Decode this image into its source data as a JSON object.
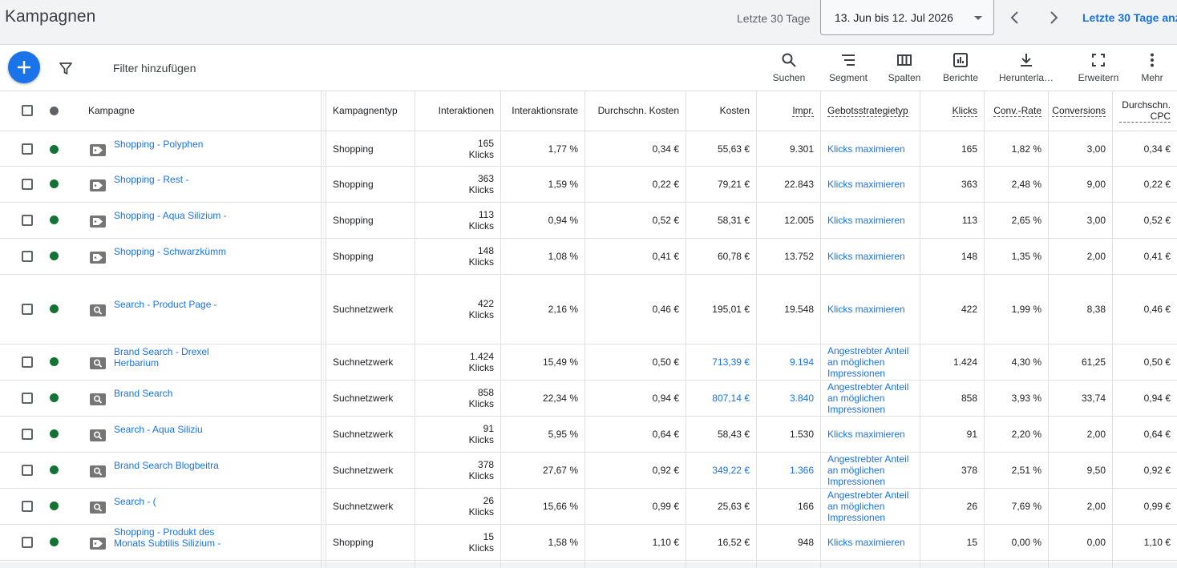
{
  "header": {
    "title": "Kampagnen",
    "range_label": "Letzte 30 Tage",
    "date_range": "13. Jun bis 12. Jul 2026",
    "compare_link": "Letzte 30 Tage anz"
  },
  "toolbar": {
    "filter_placeholder": "Filter hinzufügen",
    "search": "Suchen",
    "segment": "Segment",
    "columns": "Spalten",
    "reports": "Berichte",
    "download": "Herunterla…",
    "expand": "Erweitern",
    "more": "Mehr"
  },
  "table": {
    "columns": {
      "campaign": "Kampagne",
      "type": "Kampagnentyp",
      "interactions": "Interaktionen",
      "interaction_rate": "Interaktionsrate",
      "avg_cost": "Durchschn. Kosten",
      "cost": "Kosten",
      "impr": "Impr.",
      "bid_strategy": "Gebotsstrategietyp",
      "clicks": "Klicks",
      "conv_rate": "Conv.-Rate",
      "conversions": "Conversions",
      "avg_cpc": "Durchschn. CPC"
    },
    "status_color": "#137333",
    "rows": [
      {
        "name": "Shopping - Polyphen",
        "icon": "tag-icon",
        "type": "Shopping",
        "interactions": "165",
        "interactions_unit": "Klicks",
        "interaction_rate": "1,77 %",
        "avg_cost": "0,34 €",
        "cost": "55,63 €",
        "impr": "9.301",
        "bid_strategy": "Klicks maximieren",
        "clicks": "165",
        "conv_rate": "1,82 %",
        "conversions": "3,00",
        "avg_cpc": "0,34 €"
      },
      {
        "name": "Shopping - Rest -",
        "icon": "tag-icon",
        "type": "Shopping",
        "interactions": "363",
        "interactions_unit": "Klicks",
        "interaction_rate": "1,59 %",
        "avg_cost": "0,22 €",
        "cost": "79,21 €",
        "impr": "22.843",
        "bid_strategy": "Klicks maximieren",
        "clicks": "363",
        "conv_rate": "2,48 %",
        "conversions": "9,00",
        "avg_cpc": "0,22 €"
      },
      {
        "name": "Shopping - Aqua Silizium -",
        "icon": "tag-icon",
        "type": "Shopping",
        "interactions": "113",
        "interactions_unit": "Klicks",
        "interaction_rate": "0,94 %",
        "avg_cost": "0,52 €",
        "cost": "58,31 €",
        "impr": "12.005",
        "bid_strategy": "Klicks maximieren",
        "clicks": "113",
        "conv_rate": "2,65 %",
        "conversions": "3,00",
        "avg_cpc": "0,52 €"
      },
      {
        "name": "Shopping - Schwarzkümmelöl",
        "icon": "tag-icon",
        "type": "Shopping",
        "interactions": "148",
        "interactions_unit": "Klicks",
        "interaction_rate": "1,08 %",
        "avg_cost": "0,41 €",
        "cost": "60,78 €",
        "impr": "13.752",
        "bid_strategy": "Klicks maximieren",
        "clicks": "148",
        "conv_rate": "1,35 %",
        "conversions": "2,00",
        "avg_cpc": "0,41 €"
      },
      {
        "name": "Search - Product Page -",
        "icon": "search-tag-icon",
        "type": "Suchnetzwerk",
        "interactions": "422",
        "interactions_unit": "Klicks",
        "interaction_rate": "2,16 %",
        "avg_cost": "0,46 €",
        "cost": "195,01 €",
        "impr": "19.548",
        "bid_strategy": "Klicks maximieren",
        "clicks": "422",
        "conv_rate": "1,99 %",
        "conversions": "8,38",
        "avg_cpc": "0,46 €"
      },
      {
        "name": "Brand Search - Drexel Herbarium",
        "icon": "search-tag-icon",
        "type": "Suchnetzwerk",
        "interactions": "1.424",
        "interactions_unit": "Klicks",
        "interaction_rate": "15,49 %",
        "avg_cost": "0,50 €",
        "cost": "713,39 €",
        "impr": "9.194",
        "bid_strategy": "Angestrebter Anteil an möglichen Impressionen",
        "clicks": "1.424",
        "conv_rate": "4,30 %",
        "conversions": "61,25",
        "avg_cpc": "0,50 €"
      },
      {
        "name": "Brand Search",
        "icon": "search-tag-icon",
        "type": "Suchnetzwerk",
        "interactions": "858",
        "interactions_unit": "Klicks",
        "interaction_rate": "22,34 %",
        "avg_cost": "0,94 €",
        "cost": "807,14 €",
        "impr": "3.840",
        "bid_strategy": "Angestrebter Anteil an möglichen Impressionen",
        "clicks": "858",
        "conv_rate": "3,93 %",
        "conversions": "33,74",
        "avg_cpc": "0,94 €"
      },
      {
        "name": "Search - Aqua Siliziu",
        "icon": "search-tag-icon",
        "type": "Suchnetzwerk",
        "interactions": "91",
        "interactions_unit": "Klicks",
        "interaction_rate": "5,95 %",
        "avg_cost": "0,64 €",
        "cost": "58,43 €",
        "impr": "1.530",
        "bid_strategy": "Klicks maximieren",
        "clicks": "91",
        "conv_rate": "2,20 %",
        "conversions": "2,00",
        "avg_cpc": "0,64 €"
      },
      {
        "name": "Brand Search Blogbeitra",
        "icon": "search-tag-icon",
        "type": "Suchnetzwerk",
        "interactions": "378",
        "interactions_unit": "Klicks",
        "interaction_rate": "27,67 %",
        "avg_cost": "0,92 €",
        "cost": "349,22 €",
        "impr": "1.366",
        "bid_strategy": "Angestrebter Anteil an möglichen Impressionen",
        "clicks": "378",
        "conv_rate": "2,51 %",
        "conversions": "9,50",
        "avg_cpc": "0,92 €"
      },
      {
        "name": "Search - (",
        "icon": "search-tag-icon",
        "type": "Suchnetzwerk",
        "interactions": "26",
        "interactions_unit": "Klicks",
        "interaction_rate": "15,66 %",
        "avg_cost": "0,99 €",
        "cost": "25,63 €",
        "impr": "166",
        "bid_strategy": "Angestrebter Anteil an möglichen Impressionen",
        "clicks": "26",
        "conv_rate": "7,69 %",
        "conversions": "2,00",
        "avg_cpc": "0,99 €"
      },
      {
        "name": "Shopping - Produkt des Monats Subtilis Silizium -",
        "icon": "tag-icon",
        "type": "Shopping",
        "interactions": "15",
        "interactions_unit": "Klicks",
        "interaction_rate": "1,58 %",
        "avg_cost": "1,10 €",
        "cost": "16,52 €",
        "impr": "948",
        "bid_strategy": "Klicks maximieren",
        "clicks": "15",
        "conv_rate": "0,00 %",
        "conversions": "0,00",
        "avg_cpc": "1,10 €"
      }
    ]
  }
}
